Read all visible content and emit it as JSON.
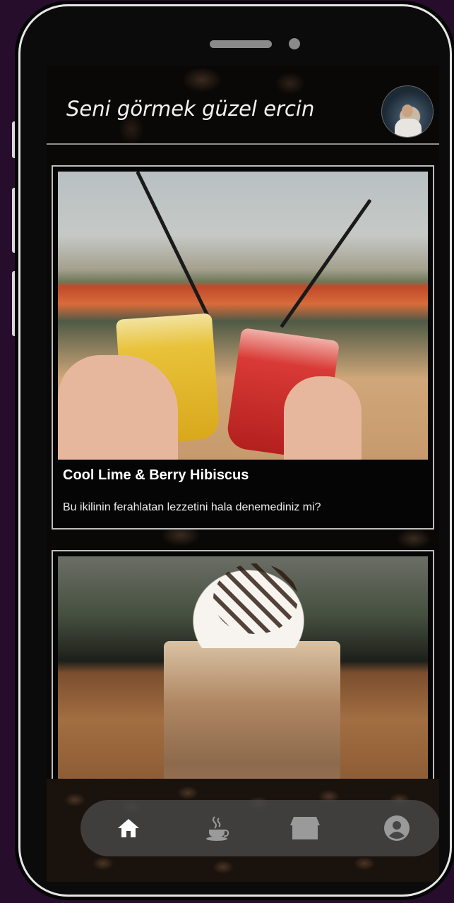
{
  "header": {
    "greeting": "Seni görmek güzel ercin"
  },
  "cards": [
    {
      "title": "Cool Lime & Berry Hibiscus",
      "description": "Bu ikilinin ferahlatan lezzetini hala denemediniz mi?"
    },
    {
      "title": "",
      "description": ""
    }
  ],
  "nav": {
    "items": [
      {
        "icon": "home-icon",
        "active": true
      },
      {
        "icon": "coffee-cup-icon",
        "active": false
      },
      {
        "icon": "store-icon",
        "active": false
      },
      {
        "icon": "profile-icon",
        "active": false
      }
    ]
  },
  "colors": {
    "background": "#260d2c",
    "screen": "#0a0806",
    "nav_bg": "#464646",
    "active_icon": "#ffffff",
    "inactive_icon": "#9a9a9a"
  }
}
